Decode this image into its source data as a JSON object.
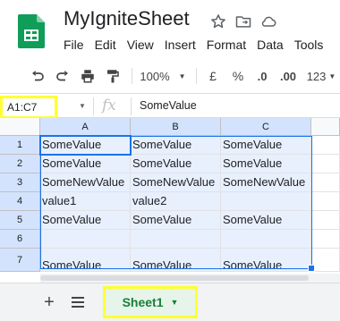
{
  "app": {
    "doc_title": "MyIgniteSheet",
    "brand_color": "#0f9d58",
    "accent_color": "#1a73e8",
    "highlight_color": "#ffff33"
  },
  "header": {
    "icons": [
      "star-icon",
      "move-folder-icon",
      "cloud-status-icon"
    ]
  },
  "menu": {
    "items": [
      "File",
      "Edit",
      "View",
      "Insert",
      "Format",
      "Data",
      "Tools"
    ]
  },
  "toolbar": {
    "zoom": "100%",
    "currency": "£",
    "percent": "%",
    "decrease_decimal": ".0",
    "increase_decimal": ".00",
    "more_formats": "123"
  },
  "formula_bar": {
    "name_box": "A1:C7",
    "fx": "fx",
    "value": "SomeValue"
  },
  "grid": {
    "columns": [
      "A",
      "B",
      "C"
    ],
    "rows": [
      "1",
      "2",
      "3",
      "4",
      "5",
      "6",
      "7"
    ],
    "cells": [
      [
        "SomeValue",
        "SomeValue",
        "SomeValue"
      ],
      [
        "SomeValue",
        "SomeValue",
        "SomeValue"
      ],
      [
        "SomeNewValue",
        "SomeNewValue",
        "SomeNewValue"
      ],
      [
        "value1",
        "value2",
        ""
      ],
      [
        "SomeValue",
        "SomeValue",
        "SomeValue"
      ],
      [
        "",
        "",
        ""
      ],
      [
        "SomeValue",
        "SomeValue",
        "SomeValue"
      ]
    ]
  },
  "bottom": {
    "sheet_tab": "Sheet1"
  }
}
